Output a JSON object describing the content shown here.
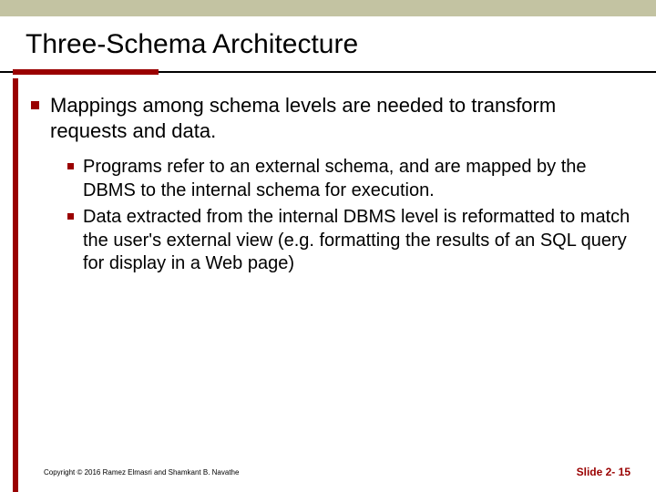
{
  "title": "Three-Schema Architecture",
  "bullets": {
    "main": "Mappings among schema levels are needed to transform requests and data.",
    "sub": [
      "Programs refer to an external schema, and are mapped by the DBMS to the internal schema for execution.",
      "Data extracted from the internal DBMS level is reformatted to match the user's external view (e.g. formatting the results of an SQL query for display in a Web page)"
    ]
  },
  "footer": {
    "copyright": "Copyright © 2016 Ramez Elmasri and Shamkant B. Navathe",
    "slide": "Slide 2- 15"
  }
}
